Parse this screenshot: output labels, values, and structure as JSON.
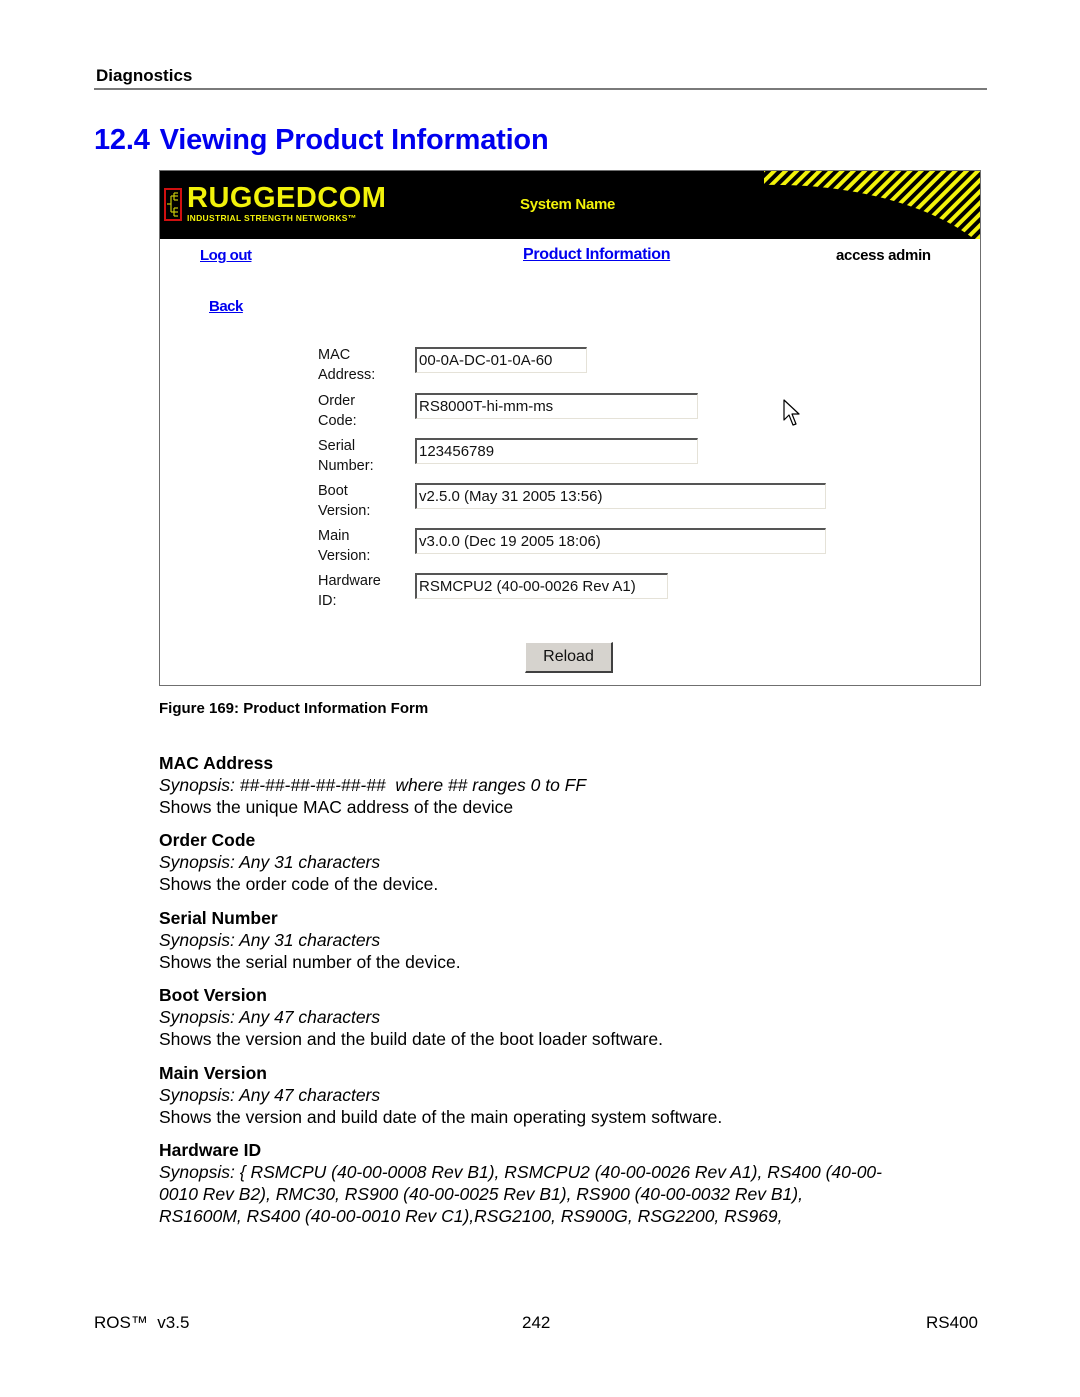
{
  "document": {
    "running_header": "Diagnostics",
    "section_number": "12.4",
    "section_title": "Viewing Product Information",
    "figure_caption": "Figure 169: Product Information Form"
  },
  "screenshot": {
    "banner": {
      "logo_word": "RUGGEDCOM",
      "logo_tagline": "INDUSTRIAL STRENGTH NETWORKS™",
      "system_name": "System Name",
      "colors": {
        "background": "#000000",
        "accent": "#f2f20a",
        "logo_border": "#d01010"
      }
    },
    "nav": {
      "logout_label": "Log out",
      "page_title": "Product Information",
      "access_label": "access admin",
      "back_label": "Back",
      "link_color": "#0000ee"
    },
    "fields": [
      {
        "label_line1": "MAC",
        "label_line2": "Address:",
        "value": "00-0A-DC-01-0A-60"
      },
      {
        "label_line1": "Order",
        "label_line2": "Code:",
        "value": "RS8000T-hi-mm-ms"
      },
      {
        "label_line1": "Serial",
        "label_line2": "Number:",
        "value": "123456789"
      },
      {
        "label_line1": "Boot",
        "label_line2": "Version:",
        "value": "v2.5.0 (May 31 2005 13:56)"
      },
      {
        "label_line1": "Main",
        "label_line2": "Version:",
        "value": "v3.0.0 (Dec 19 2005 18:06)"
      },
      {
        "label_line1": "Hardware",
        "label_line2": "ID:",
        "value": "RSMCPU2 (40-00-0026 Rev A1)"
      }
    ],
    "reload_label": "Reload",
    "cursor_icon": "mouse-pointer-icon"
  },
  "parameters": [
    {
      "title": "MAC Address",
      "synopsis": "Synopsis: ##-##-##-##-##-##  where ## ranges 0 to FF",
      "description": "Shows the unique MAC address of the device"
    },
    {
      "title": "Order Code",
      "synopsis": "Synopsis: Any 31 characters",
      "description": "Shows the order code of the device."
    },
    {
      "title": "Serial Number",
      "synopsis": "Synopsis: Any 31 characters",
      "description": "Shows the serial number of the device."
    },
    {
      "title": "Boot Version",
      "synopsis": "Synopsis: Any 47 characters",
      "description": "Shows the version and the build date of the boot loader software."
    },
    {
      "title": "Main Version",
      "synopsis": "Synopsis: Any 47 characters",
      "description": "Shows the version and build date of the main operating system software."
    },
    {
      "title": "Hardware ID",
      "synopsis_lines": [
        "Synopsis: { RSMCPU (40-00-0008 Rev B1), RSMCPU2 (40-00-0026 Rev A1), RS400 (40-00-",
        "0010 Rev B2), RMC30, RS900 (40-00-0025 Rev B1), RS900 (40-00-0032 Rev B1),",
        "RS1600M, RS400 (40-00-0010 Rev C1),RSG2100, RS900G, RSG2200, RS969,"
      ]
    }
  ],
  "footer": {
    "left": "ROS™  v3.5",
    "center": "242",
    "right": "RS400"
  }
}
